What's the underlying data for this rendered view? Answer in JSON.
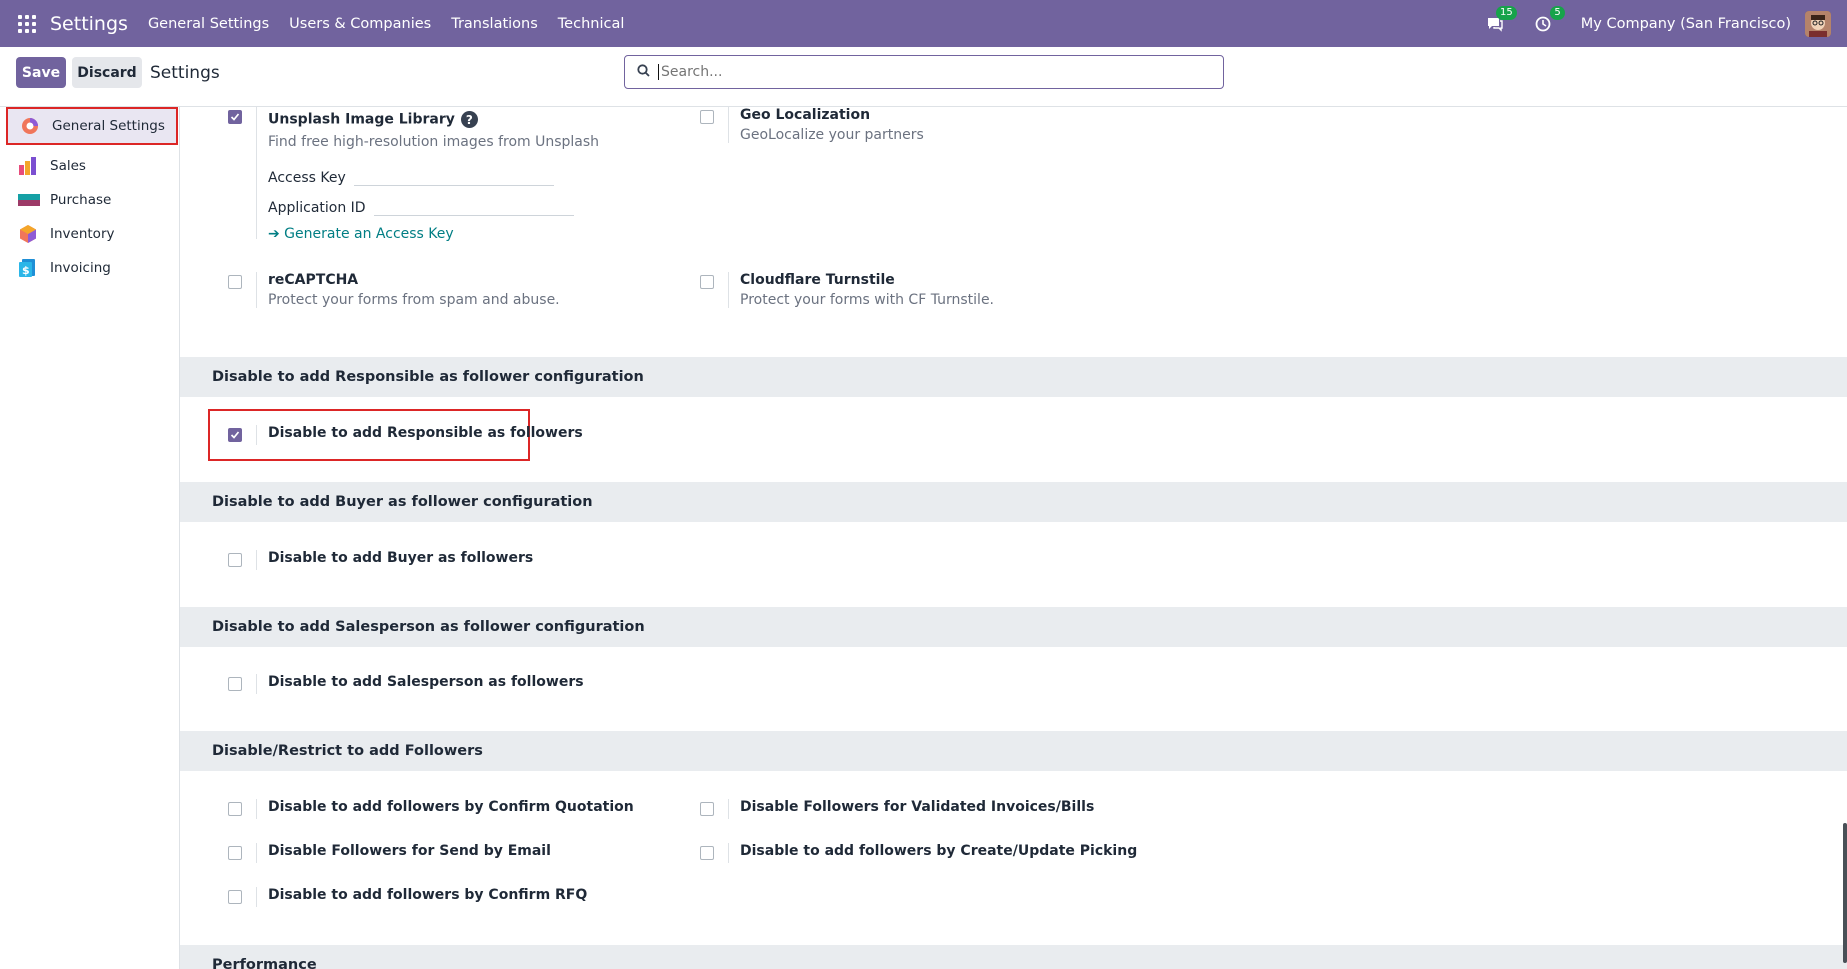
{
  "navbar": {
    "brand": "Settings",
    "menu": [
      "General Settings",
      "Users & Companies",
      "Translations",
      "Technical"
    ],
    "chat_badge": "15",
    "activity_badge": "5",
    "company": "My Company (San Francisco)"
  },
  "controlbar": {
    "save_label": "Save",
    "discard_label": "Discard",
    "title": "Settings",
    "search_placeholder": "Search..."
  },
  "sidebar": {
    "items": [
      {
        "label": "General Settings",
        "icon": "settings-app-icon",
        "active": true
      },
      {
        "label": "Sales",
        "icon": "sales-app-icon"
      },
      {
        "label": "Purchase",
        "icon": "purchase-app-icon"
      },
      {
        "label": "Inventory",
        "icon": "inventory-app-icon"
      },
      {
        "label": "Invoicing",
        "icon": "invoicing-app-icon"
      }
    ]
  },
  "integrations": {
    "unsplash": {
      "title": "Unsplash Image Library",
      "desc": "Find free high-resolution images from Unsplash",
      "access_key_label": "Access Key",
      "app_id_label": "Application ID",
      "link": "➔ Generate an Access Key",
      "checked": true
    },
    "geo": {
      "title": "Geo Localization",
      "desc": "GeoLocalize your partners",
      "checked": false
    },
    "recaptcha": {
      "title": "reCAPTCHA",
      "desc": "Protect your forms from spam and abuse.",
      "checked": false
    },
    "turnstile": {
      "title": "Cloudflare Turnstile",
      "desc": "Protect your forms with CF Turnstile.",
      "checked": false
    }
  },
  "sections": {
    "responsible": {
      "head": "Disable to add Responsible as follower configuration",
      "setting": "Disable to add Responsible as followers",
      "checked": true
    },
    "buyer": {
      "head": "Disable to add Buyer as follower configuration",
      "setting": "Disable to add Buyer as followers",
      "checked": false
    },
    "salesperson": {
      "head": "Disable to add Salesperson as follower configuration",
      "setting": "Disable to add Salesperson as followers",
      "checked": false
    },
    "restrict": {
      "head": "Disable/Restrict to add Followers",
      "settings": [
        "Disable to add followers by Confirm Quotation",
        "Disable Followers for Validated Invoices/Bills",
        "Disable Followers for Send by Email",
        "Disable to add followers by Create/Update Picking",
        "Disable to add followers by Confirm RFQ"
      ]
    },
    "performance": {
      "head": "Performance"
    }
  }
}
